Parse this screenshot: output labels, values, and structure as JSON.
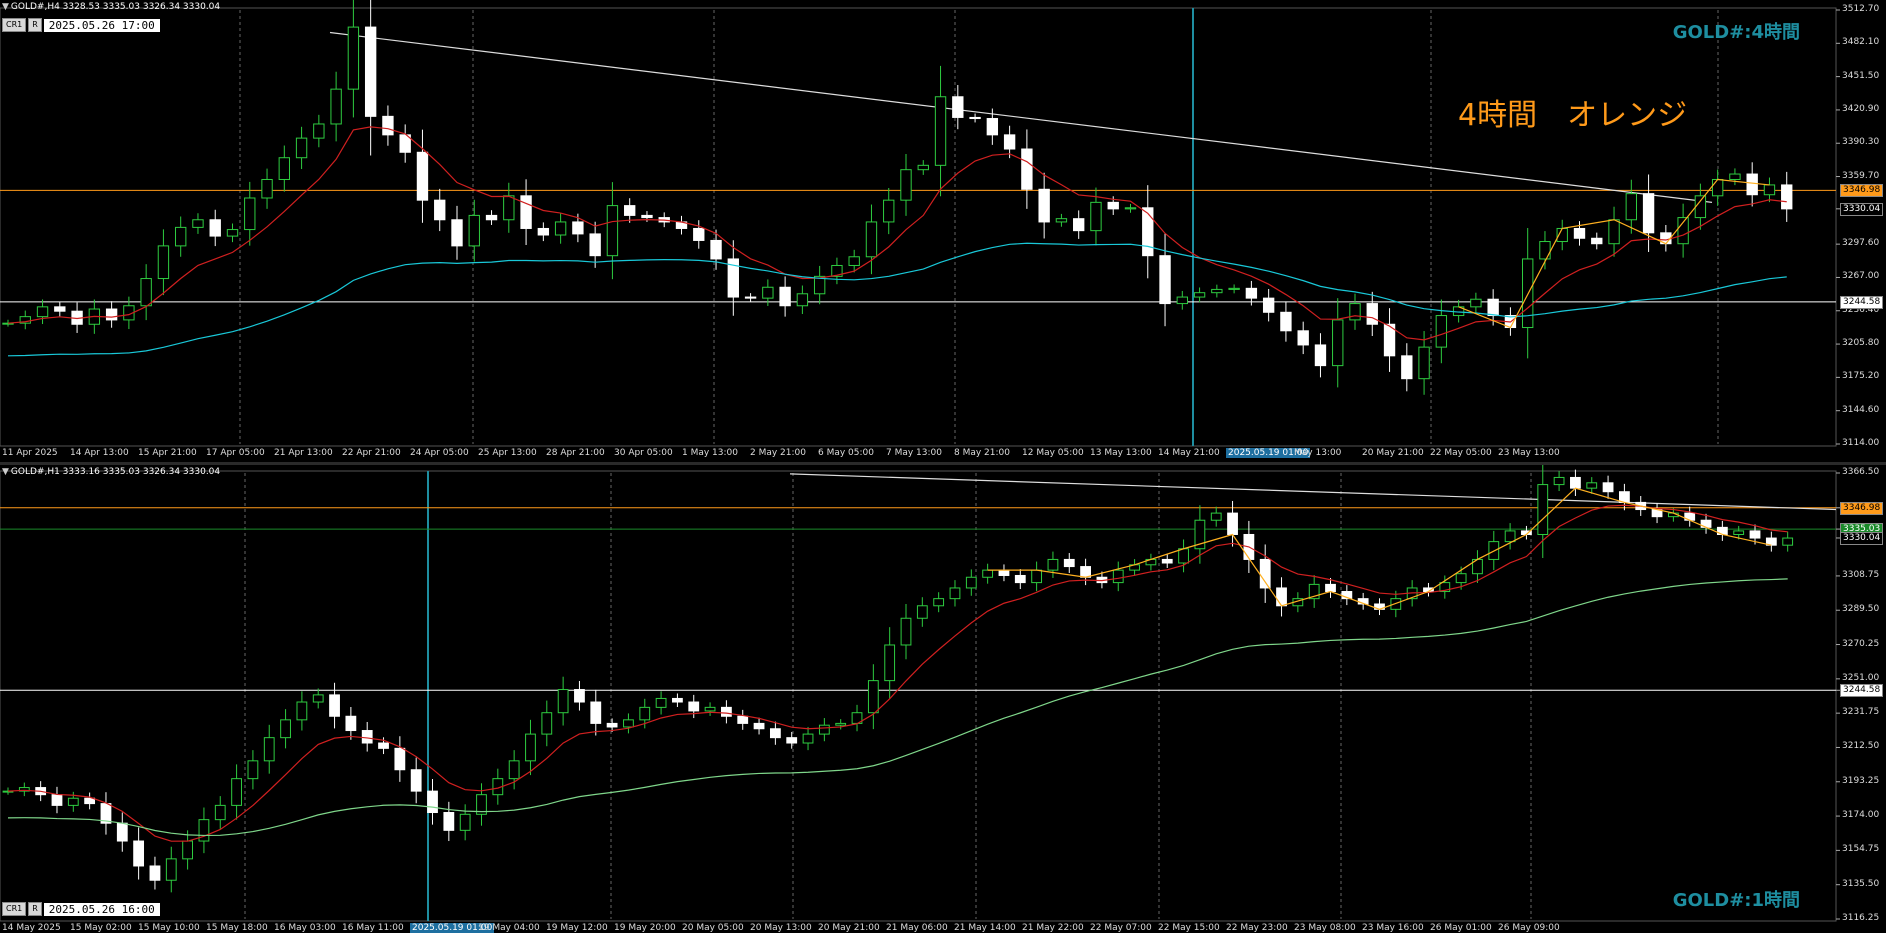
{
  "upper": {
    "header": "GOLD#,H4  3328.53 3335.03 3326.34 3330.04",
    "buttons": [
      "CR1",
      "R"
    ],
    "timestamp": "2025.05.26 17:00",
    "symbol_label": "GOLD#:4時間",
    "note": "4時間　オレンジ",
    "price_ticks": [
      "3512.70",
      "3482.10",
      "3451.50",
      "3420.90",
      "3390.30",
      "3359.70",
      "3330.04",
      "3297.60",
      "3267.00",
      "3236.40",
      "3205.80",
      "3175.20",
      "3144.60",
      "3114.00"
    ],
    "tags": [
      {
        "text": "3346.98",
        "color": "#ff9a1a",
        "fg": "#000"
      },
      {
        "text": "3330.04",
        "color": "#000",
        "fg": "#fff"
      },
      {
        "text": "3244.58",
        "color": "#fff",
        "fg": "#000"
      }
    ],
    "time_ticks": [
      "11 Apr 2025",
      "14 Apr 13:00",
      "15 Apr 21:00",
      "17 Apr 05:00",
      "21 Apr 13:00",
      "22 Apr 21:00",
      "24 Apr 05:00",
      "25 Apr 13:00",
      "28 Apr 21:00",
      "30 Apr 05:00",
      "1 May 13:00",
      "2 May 21:00",
      "6 May 05:00",
      "7 May 13:00",
      "8 May 21:00",
      "12 May 05:00",
      "13 May 13:00",
      "14 May 21:00",
      "2025.05.19 01:00",
      "May 13:00",
      "20 May 21:00",
      "22 May 05:00",
      "23 May 13:00"
    ]
  },
  "lower": {
    "header": "GOLD#,H1  3333.16 3335.03 3326.34 3330.04",
    "buttons": [
      "CR1",
      "R"
    ],
    "timestamp": "2025.05.26 16:00",
    "symbol_label": "GOLD#:1時間",
    "price_ticks": [
      "3366.50",
      "3346.98",
      "3335.03",
      "3330.04",
      "3308.75",
      "3289.50",
      "3270.25",
      "3251.00",
      "3244.58",
      "3231.75",
      "3212.50",
      "3193.25",
      "3174.00",
      "3154.75",
      "3135.50",
      "3116.25"
    ],
    "tags": [
      {
        "text": "3346.98",
        "color": "#ff9a1a",
        "fg": "#000"
      },
      {
        "text": "3335.03",
        "color": "#1a8a2a",
        "fg": "#fff"
      },
      {
        "text": "3330.04",
        "color": "#000",
        "fg": "#fff"
      },
      {
        "text": "3244.58",
        "color": "#fff",
        "fg": "#000"
      }
    ],
    "time_ticks": [
      "14 May 2025",
      "15 May 02:00",
      "15 May 10:00",
      "15 May 18:00",
      "16 May 03:00",
      "16 May 11:00",
      "2025.05.19 01:00",
      "19 May 04:00",
      "19 May 12:00",
      "19 May 20:00",
      "20 May 05:00",
      "20 May 13:00",
      "20 May 21:00",
      "21 May 06:00",
      "21 May 14:00",
      "21 May 22:00",
      "22 May 07:00",
      "22 May 15:00",
      "22 May 23:00",
      "23 May 08:00",
      "23 May 16:00",
      "26 May 01:00",
      "26 May 09:00"
    ]
  },
  "chart_data": [
    {
      "type": "candlestick",
      "title": "GOLD#,H4",
      "ylim": [
        3114.0,
        3512.7
      ],
      "horizontal_levels": [
        3346.98,
        3244.58
      ],
      "last_price": 3330.04,
      "close_path": [
        3225,
        3231,
        3240,
        3236,
        3224,
        3238,
        3228,
        3241,
        3266,
        3296,
        3313,
        3320,
        3305,
        3311,
        3340,
        3357,
        3377,
        3395,
        3408,
        3440,
        3497,
        3415,
        3398,
        3382,
        3338,
        3320,
        3296,
        3324,
        3320,
        3342,
        3312,
        3306,
        3318,
        3307,
        3287,
        3333,
        3324,
        3322,
        3318,
        3312,
        3301,
        3284,
        3249,
        3248,
        3258,
        3241,
        3252,
        3268,
        3278,
        3286,
        3318,
        3338,
        3366,
        3370,
        3433,
        3414,
        3413,
        3398,
        3385,
        3348,
        3318,
        3321,
        3310,
        3336,
        3330,
        3331,
        3287,
        3243,
        3249,
        3253,
        3256,
        3257,
        3248,
        3235,
        3218,
        3205,
        3186,
        3228,
        3243,
        3224,
        3195,
        3174,
        3203,
        3232,
        3240,
        3247,
        3232,
        3221,
        3284,
        3300,
        3312,
        3303,
        3298,
        3320,
        3344,
        3308,
        3298,
        3322,
        3342,
        3357,
        3362,
        3343,
        3352,
        3330
      ],
      "series": [
        {
          "name": "EMA red",
          "color": "#d02020"
        },
        {
          "name": "SMA cyan",
          "color": "#19c8d8"
        }
      ]
    },
    {
      "type": "candlestick",
      "title": "GOLD#,H1",
      "ylim": [
        3116.25,
        3366.5
      ],
      "horizontal_levels": [
        3346.98,
        3335.03,
        3244.58
      ],
      "last_price": 3330.04,
      "close_path": [
        3188,
        3190,
        3186,
        3180,
        3184,
        3181,
        3170,
        3160,
        3146,
        3138,
        3150,
        3160,
        3172,
        3180,
        3195,
        3205,
        3218,
        3228,
        3238,
        3242,
        3230,
        3222,
        3215,
        3212,
        3200,
        3188,
        3176,
        3166,
        3175,
        3186,
        3195,
        3205,
        3220,
        3232,
        3245,
        3238,
        3226,
        3224,
        3228,
        3235,
        3240,
        3238,
        3233,
        3235,
        3230,
        3226,
        3223,
        3218,
        3215,
        3220,
        3225,
        3226,
        3232,
        3250,
        3270,
        3285,
        3292,
        3296,
        3302,
        3308,
        3312,
        3309,
        3305,
        3312,
        3318,
        3314,
        3308,
        3305,
        3312,
        3315,
        3318,
        3316,
        3324,
        3340,
        3344,
        3332,
        3318,
        3302,
        3292,
        3296,
        3304,
        3300,
        3296,
        3293,
        3290,
        3296,
        3302,
        3300,
        3305,
        3310,
        3318,
        3328,
        3334,
        3332,
        3360,
        3364,
        3358,
        3361,
        3356,
        3350,
        3346,
        3342,
        3344,
        3340,
        3336,
        3332,
        3334,
        3330,
        3326,
        3330
      ],
      "series": [
        {
          "name": "EMA red",
          "color": "#d02020"
        },
        {
          "name": "SMA green",
          "color": "#7fd68a"
        }
      ]
    }
  ]
}
